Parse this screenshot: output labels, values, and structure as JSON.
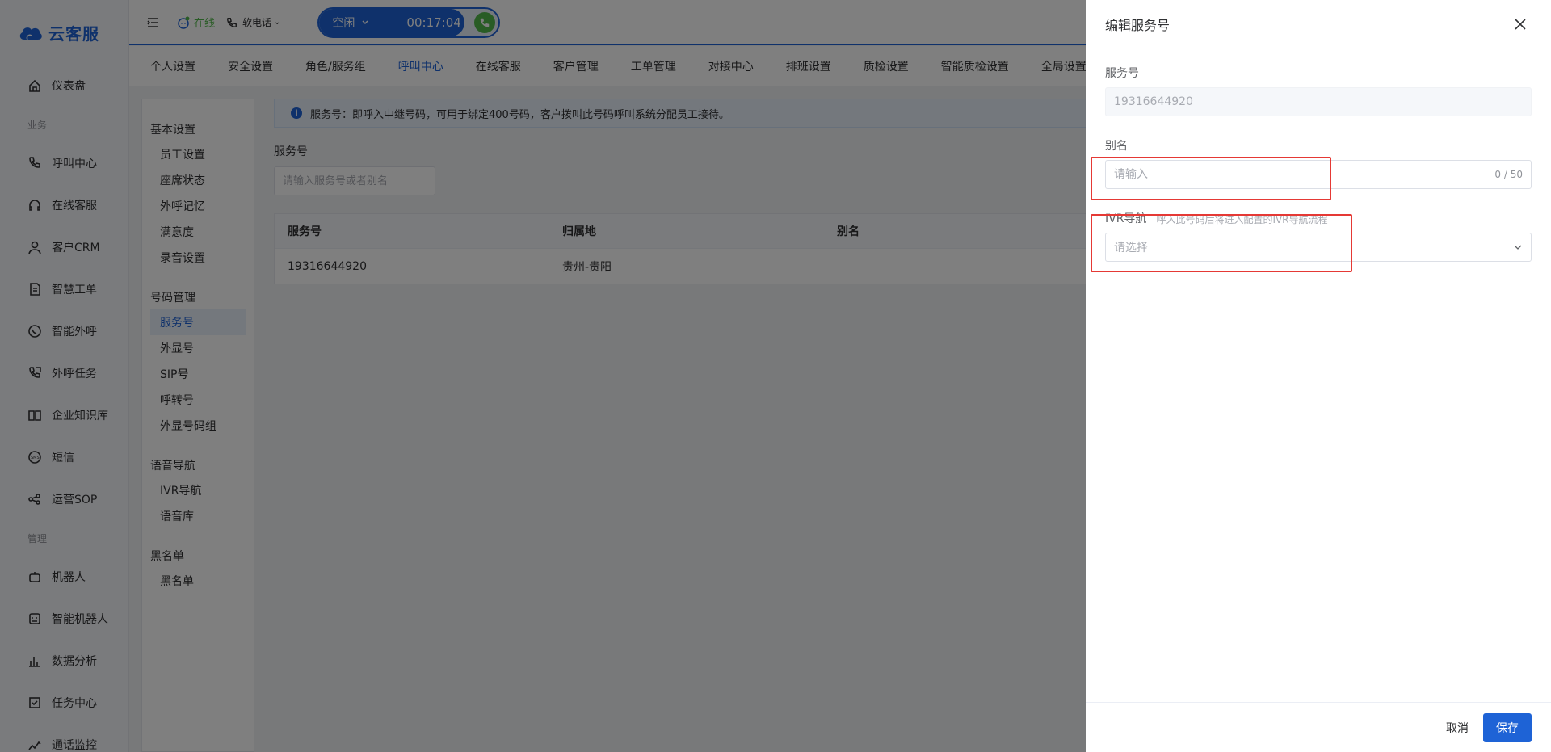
{
  "app": {
    "brand": "云客服"
  },
  "nav": {
    "items": [
      {
        "label": "仪表盘",
        "icon": "home-icon"
      },
      {
        "group": "业务"
      },
      {
        "label": "呼叫中心",
        "icon": "phone-icon"
      },
      {
        "label": "在线客服",
        "icon": "headset-icon"
      },
      {
        "label": "客户CRM",
        "icon": "user-icon"
      },
      {
        "label": "智慧工单",
        "icon": "ticket-icon"
      },
      {
        "label": "智能外呼",
        "icon": "whatsapp-icon"
      },
      {
        "label": "外呼任务",
        "icon": "outcall-icon"
      },
      {
        "label": "企业知识库",
        "icon": "book-icon"
      },
      {
        "label": "短信",
        "icon": "sms-icon"
      },
      {
        "label": "运营SOP",
        "icon": "share-icon"
      },
      {
        "group": "管理"
      },
      {
        "label": "机器人",
        "icon": "robot-icon"
      },
      {
        "label": "智能机器人",
        "icon": "smart-robot-icon"
      },
      {
        "label": "数据分析",
        "icon": "chart-icon"
      },
      {
        "label": "任务中心",
        "icon": "task-icon"
      },
      {
        "label": "通话监控",
        "icon": "monitor-icon"
      }
    ]
  },
  "topbar": {
    "online": "在线",
    "softphone": "软电话",
    "call_state": "空闲",
    "timer": "00:17:04"
  },
  "tabs": [
    "个人设置",
    "安全设置",
    "角色/服务组",
    "呼叫中心",
    "在线客服",
    "客户管理",
    "工单管理",
    "对接中心",
    "排班设置",
    "质检设置",
    "智能质检设置",
    "全局设置"
  ],
  "active_tab": "呼叫中心",
  "side_menu": [
    {
      "group": "基本设置",
      "items": [
        "员工设置",
        "座席状态",
        "外呼记忆",
        "满意度",
        "录音设置"
      ]
    },
    {
      "group": "号码管理",
      "items": [
        "服务号",
        "外显号",
        "SIP号",
        "呼转号",
        "外显号码组"
      ]
    },
    {
      "group": "语音导航",
      "items": [
        "IVR导航",
        "语音库"
      ]
    },
    {
      "group": "黑名单",
      "items": [
        "黑名单"
      ]
    }
  ],
  "main": {
    "info": "服务号：即呼入中继号码，可用于绑定400号码，客户拨叫此号码呼叫系统分配员工接待。",
    "search_label": "服务号",
    "search_placeholder": "请输入服务号或者别名",
    "table": {
      "headers": [
        "服务号",
        "归属地",
        "别名"
      ],
      "rows": [
        [
          "19316644920",
          "贵州-贵阳",
          ""
        ]
      ]
    }
  },
  "drawer": {
    "title": "编辑服务号",
    "service_label": "服务号",
    "service_value": "19316644920",
    "alias_label": "别名",
    "alias_placeholder": "请输入",
    "alias_counter": "0 / 50",
    "ivr_label": "IVR导航",
    "ivr_hint": "呼入此号码后将进入配置的IVR导航流程",
    "ivr_placeholder": "请选择",
    "cancel": "取消",
    "save": "保存"
  },
  "colors": {
    "primary": "#1e63d6",
    "online": "#52b84a",
    "highlight": "#e53935"
  }
}
